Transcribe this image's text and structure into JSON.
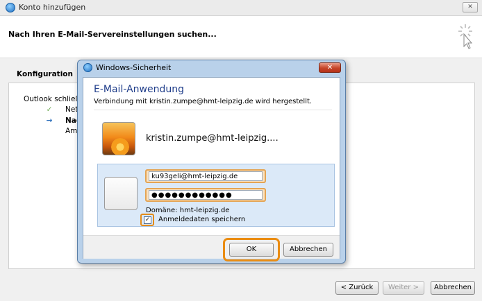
{
  "outer": {
    "title": "Konto hinzufügen",
    "close_glyph": "✕",
    "header": "Nach Ihren E-Mail-Servereinstellungen suchen...",
    "section_title": "Konfiguration",
    "intro": "Outlook schließt",
    "steps": [
      {
        "icon": "✓",
        "text": "Net",
        "bold": false
      },
      {
        "icon": "→",
        "text": "Nac",
        "bold": true
      },
      {
        "icon": "",
        "text": "Am",
        "bold": false
      }
    ],
    "buttons": {
      "back": "< Zurück",
      "next": "Weiter >",
      "cancel": "Abbrechen"
    }
  },
  "dialog": {
    "title": "Windows-Sicherheit",
    "close_glyph": "✕",
    "heading": "E-Mail-Anwendung",
    "subtitle": "Verbindung mit kristin.zumpe@hmt-leipzig.de wird hergestellt.",
    "user_display": "kristin.zumpe@hmt-leipzig....",
    "username_value": "ku93geli@hmt-leipzig.de",
    "password_mask": "●●●●●●●●●●●●",
    "domain": "Domäne: hmt-leipzig.de",
    "remember_label": "Anmeldedaten speichern",
    "remember_checked": true,
    "ok_label": "OK",
    "cancel_label": "Abbrechen"
  },
  "colors": {
    "highlight": "#ea8c12",
    "dialog_heading": "#1f3d8a",
    "dialog_frame": "#b9d1ea"
  }
}
